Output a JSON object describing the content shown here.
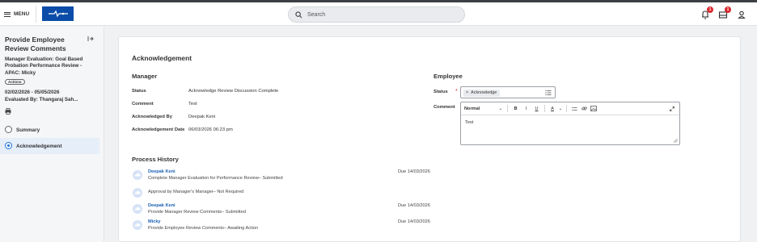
{
  "topbar": {
    "menu_label": "MENU",
    "search_placeholder": "Search",
    "notifications_count": "1",
    "inbox_count": "1"
  },
  "sidebar": {
    "title": "Provide Employee Review Comments",
    "subtitle": "Manager Evaluation: Goal Based Probation Performance Review - APAC: Micky",
    "actions_label": "Actions",
    "dates": "02/02/2026 - 05/05/2026",
    "evaluated_by": "Evaluated By: Thangaraj Sah...",
    "steps": [
      {
        "label": "Summary",
        "active": false
      },
      {
        "label": "Acknowledgement",
        "active": true
      }
    ]
  },
  "main": {
    "title": "Acknowledgement",
    "manager": {
      "heading": "Manager",
      "rows": [
        {
          "label": "Status",
          "value": "Acknowledge Review Discussion Complete"
        },
        {
          "label": "Comment",
          "value": "Test"
        },
        {
          "label": "Acknowledged By",
          "value": "Deepak Keni"
        },
        {
          "label": "Acknowledgement Date",
          "value": "06/03/2026 06:23 pm"
        }
      ]
    },
    "employee": {
      "heading": "Employee",
      "status_label": "Status",
      "required_mark": "*",
      "status_value": "Acknowledge",
      "comment_label": "Comment",
      "editor_format": "Normal",
      "editor_text": "Test"
    },
    "process_history": {
      "heading": "Process History",
      "items": [
        {
          "name": "Deepak Keni",
          "desc": "Complete Manager Evaluation for Performance Review– Submitted",
          "due": "Due 14/03/2026"
        },
        {
          "name": "",
          "desc": "Approval by Manager's Manager– Not Required",
          "due": ""
        },
        {
          "name": "Deepak Keni",
          "desc": "Provide Manager Review Comments– Submitted",
          "due": "Due 14/03/2026"
        },
        {
          "name": "Micky",
          "desc": "Provide Employee Review Comments– Awaiting Action",
          "due": "Due 14/03/2026"
        }
      ]
    }
  },
  "colors": {
    "brand": "#0a4ca8",
    "link": "#1a5fb4",
    "badge": "#d8272c",
    "active_step": "#1a6fd6"
  },
  "icons": [
    "menu-icon",
    "logo-icon",
    "search-icon",
    "notifications-icon",
    "inbox-icon",
    "profile-icon",
    "collapse-icon",
    "print-icon",
    "list-icon",
    "cloud-icon"
  ]
}
